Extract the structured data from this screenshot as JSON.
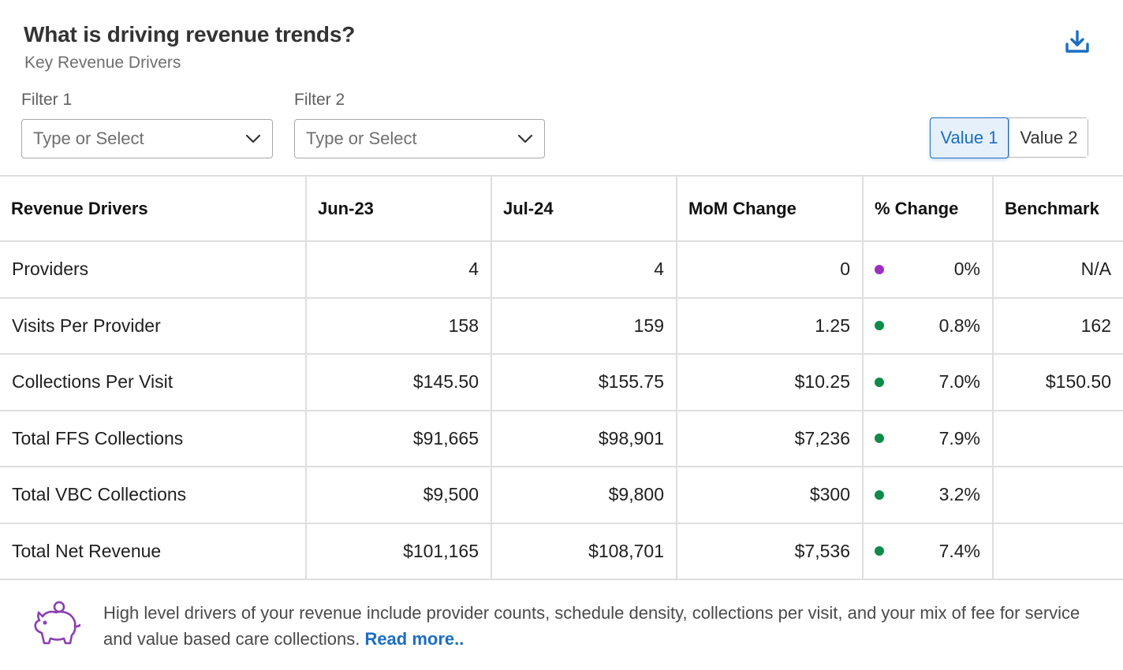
{
  "header": {
    "title": "What is driving revenue trends?",
    "subtitle": "Key Revenue Drivers",
    "download_icon": "download-icon"
  },
  "filters": [
    {
      "label": "Filter 1",
      "placeholder": "Type or Select",
      "icon": "chevron-down-icon"
    },
    {
      "label": "Filter 2",
      "placeholder": "Type or Select",
      "icon": "chevron-down-icon"
    }
  ],
  "toggle": {
    "options": [
      "Value 1",
      "Value 2"
    ],
    "selected": "Value 1"
  },
  "table": {
    "columns": [
      "Revenue Drivers",
      "Jun-23",
      "Jul-24",
      "MoM Change",
      "% Change",
      "Benchmark"
    ],
    "rows": [
      {
        "driver": "Providers",
        "jun23": "4",
        "jul24": "4",
        "mom": "0",
        "pct": "0%",
        "status_color": "#9b2fc0",
        "benchmark": "N/A"
      },
      {
        "driver": "Visits Per Provider",
        "jun23": "158",
        "jul24": "159",
        "mom": "1.25",
        "pct": "0.8%",
        "status_color": "#0e8a4a",
        "benchmark": "162"
      },
      {
        "driver": "Collections Per Visit",
        "jun23": "$145.50",
        "jul24": "$155.75",
        "mom": "$10.25",
        "pct": "7.0%",
        "status_color": "#0e8a4a",
        "benchmark": "$150.50"
      },
      {
        "driver": "Total FFS Collections",
        "jun23": "$91,665",
        "jul24": "$98,901",
        "mom": "$7,236",
        "pct": "7.9%",
        "status_color": "#0e8a4a",
        "benchmark": ""
      },
      {
        "driver": "Total VBC Collections",
        "jun23": "$9,500",
        "jul24": "$9,800",
        "mom": "$300",
        "pct": "3.2%",
        "status_color": "#0e8a4a",
        "benchmark": ""
      },
      {
        "driver": "Total Net Revenue",
        "jun23": "$101,165",
        "jul24": "$108,701",
        "mom": "$7,536",
        "pct": "7.4%",
        "status_color": "#0e8a4a",
        "benchmark": ""
      }
    ]
  },
  "footer": {
    "icon": "piggy-bank-icon",
    "text": "High level drivers of your revenue include provider counts, schedule density, collections per visit, and your mix of fee for service and value based care collections. ",
    "link": "Read more.."
  },
  "colors": {
    "accent": "#1b6ec2",
    "positive": "#0e8a4a",
    "neutral": "#9b2fc0",
    "icon_purple": "#8a3fb0"
  }
}
